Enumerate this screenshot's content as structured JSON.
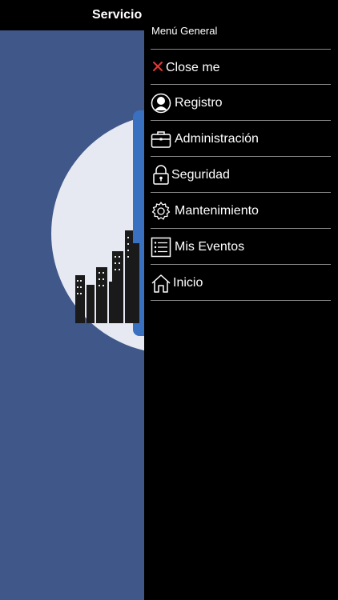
{
  "app": {
    "title": "Servicio"
  },
  "drawer": {
    "header": "Menú General",
    "items": [
      {
        "label": "Close me",
        "icon": "close-icon"
      },
      {
        "label": "Registro",
        "icon": "user-icon"
      },
      {
        "label": "Administración",
        "icon": "briefcase-icon"
      },
      {
        "label": "Seguridad",
        "icon": "lock-icon"
      },
      {
        "label": "Mantenimiento",
        "icon": "gear-icon"
      },
      {
        "label": "Mis Eventos",
        "icon": "list-icon"
      },
      {
        "label": "Inicio",
        "icon": "home-icon"
      }
    ]
  },
  "colors": {
    "drawer_bg": "#000000",
    "app_bg": "#3f5789",
    "close_icon": "#e53935",
    "divider": "#8a8a8a"
  }
}
